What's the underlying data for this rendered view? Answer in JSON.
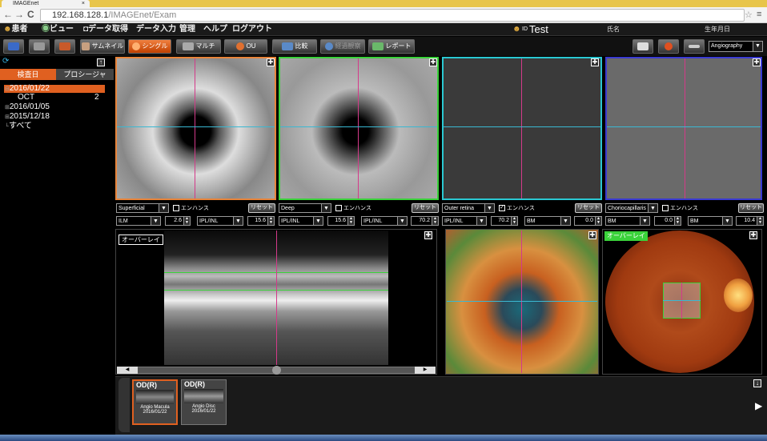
{
  "browser": {
    "tab_title": "IMAGEnet",
    "tab_close": "×",
    "url_host": "192.168.128.1",
    "url_path": "/IMAGEnet/Exam",
    "back": "←",
    "forward": "→",
    "reload": "C"
  },
  "menubar": {
    "items": [
      "患者",
      "ビュー",
      "データ取得",
      "データ入力",
      "管理",
      "ヘルプ",
      "ログアウト"
    ],
    "patient_id_label": "ID",
    "patient_id": "Test",
    "name_label": "氏名",
    "birth_label": "生年月日"
  },
  "toolbar": {
    "thumbnail": "サムネイル",
    "single": "シングル",
    "multi": "マルチ",
    "ou": "OU",
    "compare": "比較",
    "trend": "経過観察",
    "report": "レポート",
    "mode_select": "Angiography"
  },
  "left_panel": {
    "tab_date": "検査日",
    "tab_procedure": "プロシージャ",
    "tree": [
      {
        "label": "2016/01/22",
        "selected": true
      },
      {
        "label": "OCT",
        "count": "2",
        "child": true
      },
      {
        "label": "2016/01/05"
      },
      {
        "label": "2015/12/18"
      },
      {
        "label": "すべて"
      }
    ]
  },
  "angio_panels": [
    {
      "layer": "Superficial",
      "enhance_label": "エンハンス",
      "enhance": false,
      "reset": "リセット",
      "from": "ILM",
      "from_val": "2.6",
      "to": "IPL/INL",
      "to_val": "15.6",
      "border": "#e8843a"
    },
    {
      "layer": "Deep",
      "enhance_label": "エンハンス",
      "enhance": false,
      "reset": "リセット",
      "from": "IPL/INL",
      "from_val": "15.6",
      "to": "IPL/INL",
      "to_val": "70.2",
      "border": "#3ad23a"
    },
    {
      "layer": "Outer retina",
      "enhance_label": "エンハンス",
      "enhance": true,
      "reset": "リセット",
      "from": "IPL/INL",
      "from_val": "70.2",
      "to": "BM",
      "to_val": "0.0",
      "border": "#2ac8d2"
    },
    {
      "layer": "Choriocapillaris",
      "enhance_label": "エンハンス",
      "enhance": false,
      "reset": "リセット",
      "from": "BM",
      "from_val": "0.0",
      "to": "BM",
      "to_val": "10.4",
      "border": "#3a3ad2"
    }
  ],
  "overlay_label": "オーバーレイ",
  "thumbnails": [
    {
      "eye": "OD(R)",
      "name": "Angio Macula",
      "date": "2016/01/22",
      "selected": true
    },
    {
      "eye": "OD(R)",
      "name": "Angio Disc",
      "date": "2016/01/22",
      "selected": false
    }
  ],
  "colors": {
    "accent": "#e06020",
    "menubar": "#1a1a1a",
    "cursor_v": "#d43a8a",
    "cursor_h": "#3ab8d2"
  }
}
